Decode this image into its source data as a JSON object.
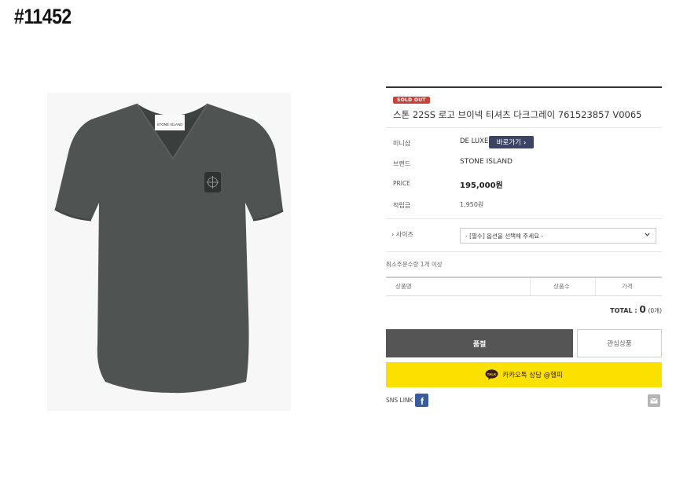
{
  "product_code": "#11452",
  "product": {
    "sold_out_badge": "SOLD OUT",
    "title": "스톤 22SS 로고 브이넥 티셔츠 다크그레이 761523857 V0065",
    "image_alt": "STONE ISLAND"
  },
  "details": {
    "minishop_label": "미니샵",
    "minishop_value": "DE LUXE",
    "goto_button": "바로가기",
    "brand_label": "브랜드",
    "brand_value": "STONE ISLAND",
    "price_label": "PRICE",
    "price_value": "195,000원",
    "points_label": "적립금",
    "points_value": "1,950원"
  },
  "options": {
    "size_label": "› 사이즈",
    "size_select_value": "- [필수] 옵션을 선택해 주세요 -",
    "min_qty_text": "최소주문수량 1개 이상"
  },
  "table": {
    "headers": [
      "상품명",
      "상품수",
      "가격"
    ]
  },
  "total": {
    "label": "TOTAL : ",
    "amount": "0",
    "count": "(0개)"
  },
  "buttons": {
    "sold_out": "품절",
    "wishlist": "관심상품",
    "kakao": "카카오톡 상담 @헬피",
    "talk_icon_text": "TALK"
  },
  "sns": {
    "label": "SNS LINK"
  },
  "icons": {
    "facebook": "facebook-icon",
    "mail": "mail-icon",
    "kakao": "kakao-talk-icon"
  },
  "colors": {
    "sold_out_badge": "#c8423a",
    "goto_button": "#3b4563",
    "sold_out_button": "#555555",
    "kakao_button": "#fae100",
    "facebook": "#3a5c9f"
  }
}
